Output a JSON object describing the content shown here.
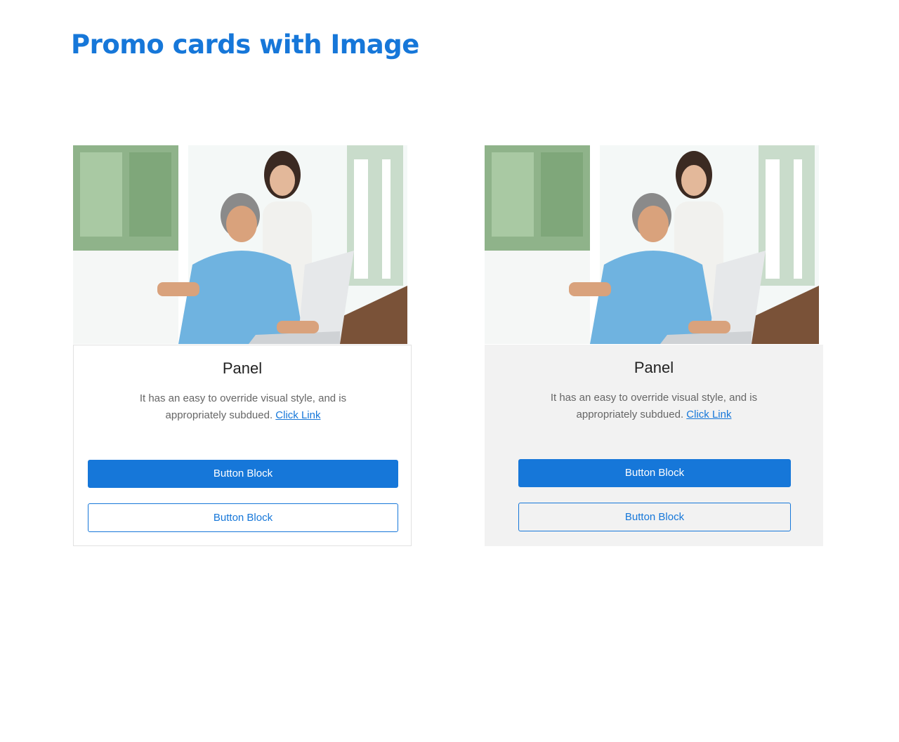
{
  "page": {
    "title": "Promo cards with Image"
  },
  "colors": {
    "accent": "#1677d9",
    "panel_gray": "#f2f2f2",
    "text_muted": "#666666"
  },
  "cards": [
    {
      "variant": "white",
      "image": "photo-couple-laptop",
      "title": "Panel",
      "text": "It has an easy to override visual style, and is appropriately subdued.",
      "link": "Click Link",
      "primary_button": "Button Block",
      "secondary_button": "Button Block"
    },
    {
      "variant": "gray",
      "image": "photo-couple-laptop",
      "title": "Panel",
      "text": "It has an easy to override visual style, and is appropriately subdued.",
      "link": "Click Link",
      "primary_button": "Button Block",
      "secondary_button": "Button Block"
    }
  ]
}
